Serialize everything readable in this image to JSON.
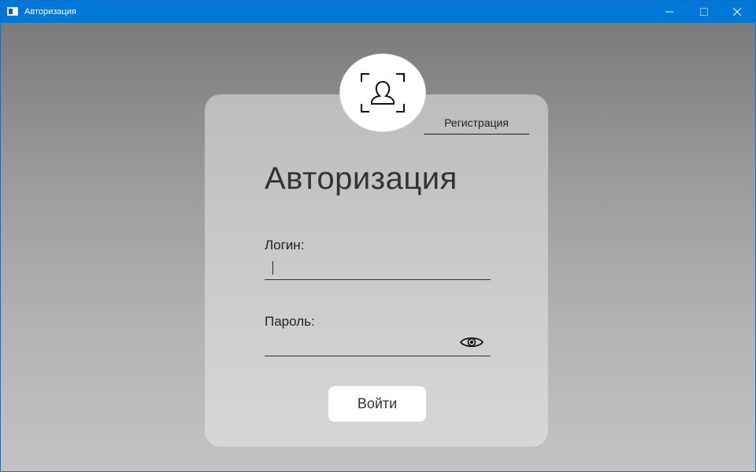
{
  "window": {
    "title": "Авторизация"
  },
  "auth": {
    "heading": "Авторизация",
    "register_link": "Регистрация",
    "login_label": "Логин:",
    "login_value": "",
    "password_label": "Пароль:",
    "password_value": "",
    "submit_label": "Войти"
  },
  "icons": {
    "app": "app-icon",
    "avatar": "user-scan-icon",
    "password_toggle": "eye-icon"
  },
  "colors": {
    "titlebar": "#0078d7",
    "card": "#c9c9c9",
    "button": "#ffffff"
  }
}
